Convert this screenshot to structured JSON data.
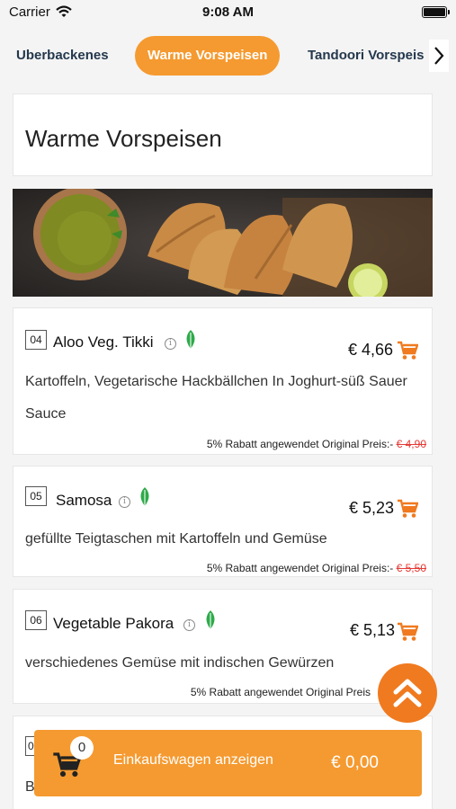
{
  "status_bar": {
    "carrier": "Carrier",
    "time": "9:08 AM"
  },
  "categories": {
    "tabs": [
      "Uberbackenes",
      "Warme Vorspeisen",
      "Tandoori Vorspeis"
    ],
    "active": "Warme Vorspeisen"
  },
  "section": {
    "title": "Warme Vorspeisen"
  },
  "items": [
    {
      "number": "04",
      "name": "Aloo Veg. Tikki",
      "price": "€ 4,66",
      "description": "Kartoffeln, Vegetarische Hackbällchen In Joghurt-süß Sauer Sauce",
      "discount_text": "5% Rabatt angewendet Original Preis:-",
      "original_price": "€ 4,90"
    },
    {
      "number": "05",
      "name": "Samosa",
      "price": "€ 5,23",
      "description": "gefüllte Teigtaschen mit Kartoffeln und Gemüse",
      "discount_text": "5% Rabatt angewendet Original Preis:-",
      "original_price": "€ 5,50"
    },
    {
      "number": "06",
      "name": "Vegetable Pakora",
      "price": "€ 5,13",
      "description": "verschiedenes Gemüse mit indischen Gewürzen",
      "discount_text": "5% Rabatt angewendet Original Preis"
    }
  ],
  "cart": {
    "count": "0",
    "label": "Einkaufswagen anzeigen",
    "total": "€ 0,00"
  },
  "peek": {
    "number": "0",
    "desc": "B"
  },
  "colors": {
    "accent": "#f59a30",
    "cart_icon": "#f07a1f",
    "strike": "#e53935",
    "leaf": "#2eaa4a"
  }
}
